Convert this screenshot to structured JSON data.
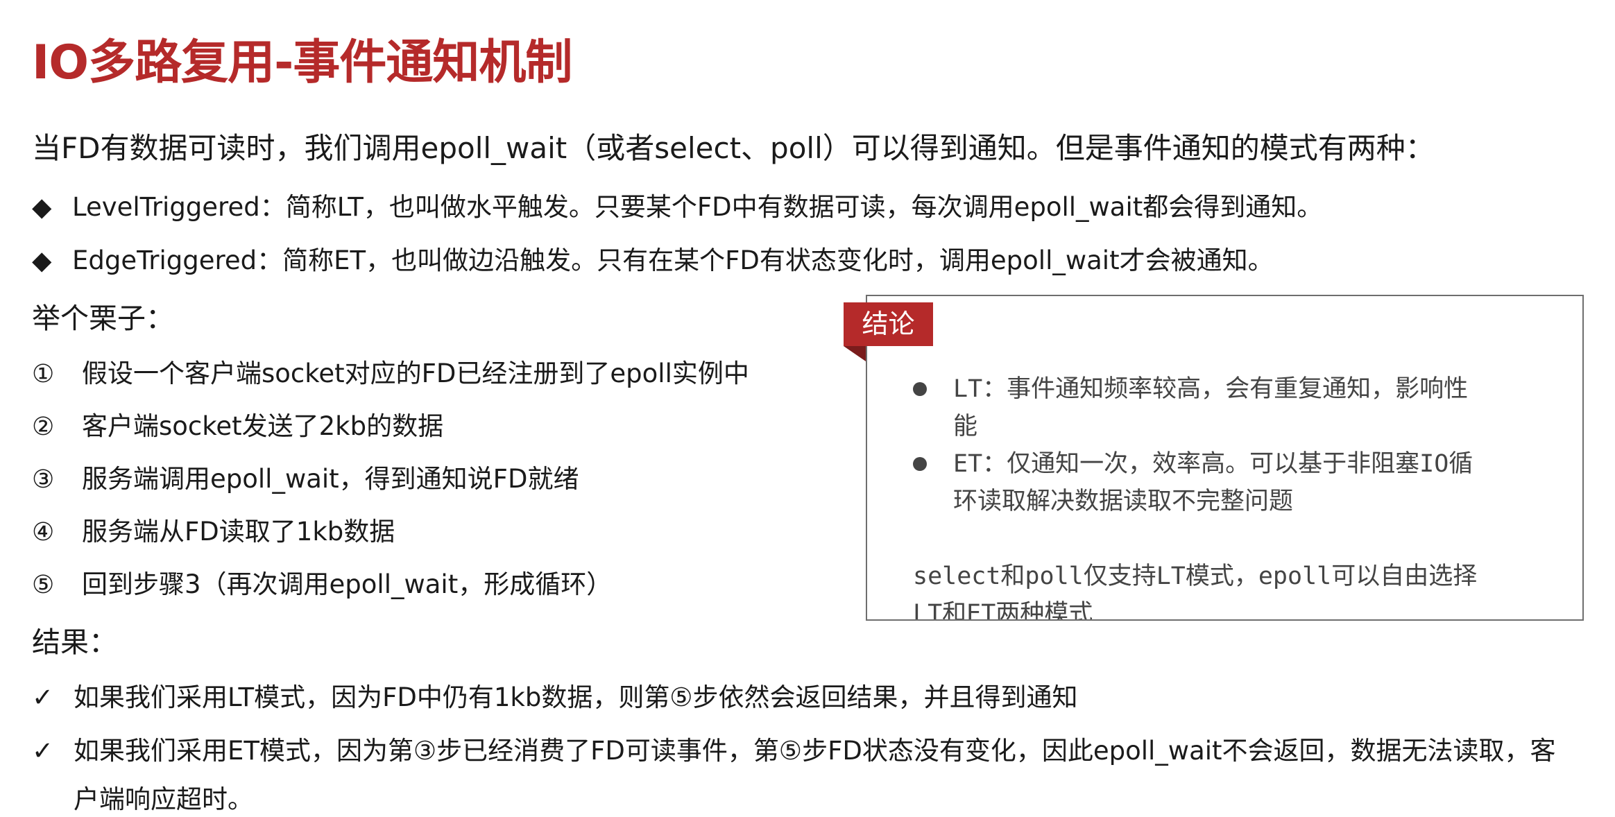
{
  "title": "IO多路复用-事件通知机制",
  "intro": "当FD有数据可读时，我们调用epoll_wait（或者select、poll）可以得到通知。但是事件通知的模式有两种：",
  "modes": [
    {
      "marker": "◆",
      "text": "LevelTriggered：简称LT，也叫做水平触发。只要某个FD中有数据可读，每次调用epoll_wait都会得到通知。"
    },
    {
      "marker": "◆",
      "text": "EdgeTriggered：简称ET，也叫做边沿触发。只有在某个FD有状态变化时，调用epoll_wait才会被通知。"
    }
  ],
  "example_heading": "举个栗子：",
  "steps": [
    {
      "num": "①",
      "text": "假设一个客户端socket对应的FD已经注册到了epoll实例中"
    },
    {
      "num": "②",
      "text": "客户端socket发送了2kb的数据"
    },
    {
      "num": "③",
      "text": "服务端调用epoll_wait，得到通知说FD就绪"
    },
    {
      "num": "④",
      "text": "服务端从FD读取了1kb数据"
    },
    {
      "num": "⑤",
      "text": "回到步骤3（再次调用epoll_wait，形成循环）"
    }
  ],
  "result_heading": "结果：",
  "results": [
    {
      "marker": "✓",
      "lines": [
        "如果我们采用LT模式，因为FD中仍有1kb数据，则第⑤步依然会返回结果，并且得到通知"
      ]
    },
    {
      "marker": "✓",
      "lines": [
        "如果我们采用ET模式，因为第③步已经消费了FD可读事件，第⑤步FD状态没有变化，因此epoll_wait不会返回，数据无法读取，客",
        "户端响应超时。"
      ]
    }
  ],
  "conclusion": {
    "tag": "结论",
    "items": [
      {
        "lines": [
          "LT：事件通知频率较高，会有重复通知，影响性",
          "能"
        ]
      },
      {
        "lines": [
          "ET：仅通知一次，效率高。可以基于非阻塞IO循",
          "环读取解决数据读取不完整问题"
        ]
      }
    ],
    "note_lines": [
      "select和poll仅支持LT模式，epoll可以自由选择",
      "LT和ET两种模式"
    ]
  },
  "colors": {
    "accent": "#b52a2a",
    "text": "#1a1a1a",
    "box_text": "#444444",
    "box_border": "#6e6e6e"
  }
}
